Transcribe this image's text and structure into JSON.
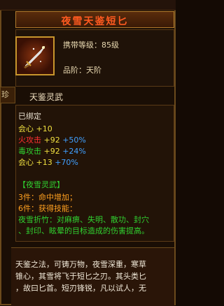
{
  "item": {
    "name": "夜雪天鉴短匕",
    "carry_level": "携带等级：85级",
    "grade": "品阶：天阶"
  },
  "side_tab": "珍",
  "section": {
    "title": "天鉴灵武"
  },
  "stats": {
    "bound": "已绑定",
    "lines": [
      {
        "label": "会心",
        "value": "+10",
        "pct": ""
      },
      {
        "label": "火攻击",
        "value": "+92",
        "pct": "+50%"
      },
      {
        "label": "毒攻击",
        "value": "+92",
        "pct": "+24%"
      },
      {
        "label": "会心",
        "value": "+13",
        "pct": "+70%"
      }
    ],
    "set_name": "【夜雪灵武】",
    "set3": "3件：命中增加；",
    "set6": "6件：获得技能：",
    "skill1": "夜雪折竹：对麻痹、失明、散功、封穴",
    "skill2": "、封印、眩晕的目标造成的伤害提高。"
  },
  "description": {
    "line1": "天鉴之法，可铸万物，夜雪深重，寒草",
    "line2": "锥心，其雪将飞于短匕之刃。其头类匕",
    "line3": "，故曰匕首。短刃锋锐，凡以试人，无"
  },
  "colors": {
    "title": "#ff5a20",
    "fire": "#ff3030",
    "poison": "#30d030",
    "percent": "#40a0ff",
    "set_name": "#30d030"
  }
}
